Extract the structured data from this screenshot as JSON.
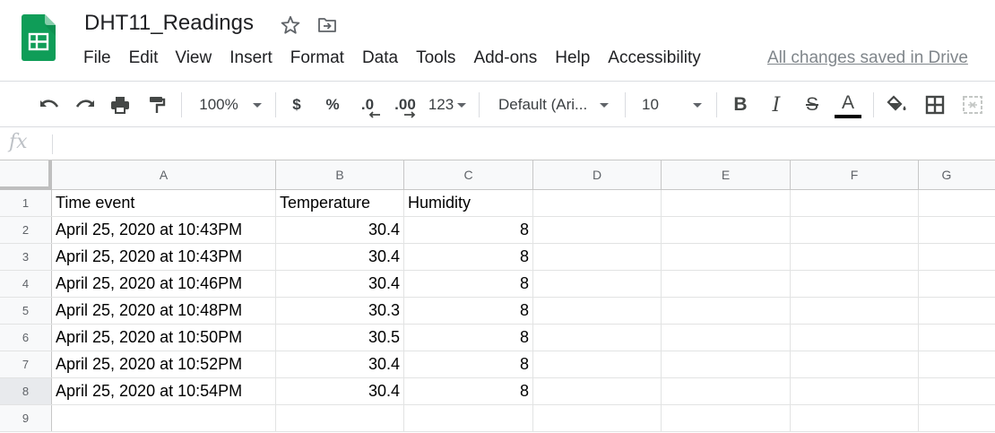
{
  "document": {
    "title": "DHT11_Readings",
    "save_status": "All changes saved in Drive"
  },
  "icons": {
    "logo": "google-sheets-logo",
    "star": "star-icon",
    "move": "move-to-folder-icon"
  },
  "menu": [
    "File",
    "Edit",
    "View",
    "Insert",
    "Format",
    "Data",
    "Tools",
    "Add-ons",
    "Help",
    "Accessibility"
  ],
  "toolbar": {
    "zoom": "100%",
    "currency": "$",
    "percent": "%",
    "decrease_decimal": ".0",
    "increase_decimal": ".00",
    "more_formats": "123",
    "font": "Default (Ari...",
    "font_size": "10",
    "bold": "B",
    "italic": "I",
    "strikethrough": "S",
    "text_color": "A",
    "text_color_value": "#000000"
  },
  "formula_bar": {
    "fx_label": "fx",
    "value": ""
  },
  "columns": [
    "A",
    "B",
    "C",
    "D",
    "E",
    "F",
    "G"
  ],
  "rows": [
    {
      "num": "1",
      "cells": [
        "Time event",
        "Temperature",
        "Humidity"
      ]
    },
    {
      "num": "2",
      "cells": [
        "April 25, 2020 at 10:43PM",
        "30.4",
        "8"
      ]
    },
    {
      "num": "3",
      "cells": [
        "April 25, 2020 at 10:43PM",
        "30.4",
        "8"
      ]
    },
    {
      "num": "4",
      "cells": [
        "April 25, 2020 at 10:46PM",
        "30.4",
        "8"
      ]
    },
    {
      "num": "5",
      "cells": [
        "April 25, 2020 at 10:48PM",
        "30.3",
        "8"
      ]
    },
    {
      "num": "6",
      "cells": [
        "April 25, 2020 at 10:50PM",
        "30.5",
        "8"
      ]
    },
    {
      "num": "7",
      "cells": [
        "April 25, 2020 at 10:52PM",
        "30.4",
        "8"
      ]
    },
    {
      "num": "8",
      "cells": [
        "April 25, 2020 at 10:54PM",
        "30.4",
        "8"
      ]
    },
    {
      "num": "9",
      "cells": [
        "",
        "",
        ""
      ]
    }
  ],
  "selected_row": "8",
  "colors": {
    "sheets_green": "#0F9D58",
    "header_bg": "#f8f9fa",
    "grid_line": "#e2e3e3"
  }
}
